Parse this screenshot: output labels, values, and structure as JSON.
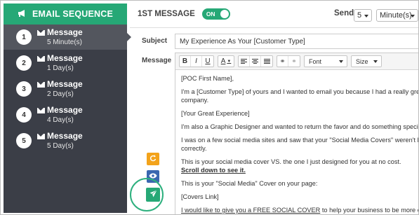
{
  "sidebar": {
    "header": "EMAIL SEQUENCE",
    "items": [
      {
        "number": "1",
        "title": "Message",
        "delay": "5 Minute(s)",
        "active": true
      },
      {
        "number": "2",
        "title": "Message",
        "delay": "1 Day(s)",
        "active": false
      },
      {
        "number": "3",
        "title": "Message",
        "delay": "2 Day(s)",
        "active": false
      },
      {
        "number": "4",
        "title": "Message",
        "delay": "4 Day(s)",
        "active": false
      },
      {
        "number": "5",
        "title": "Message",
        "delay": "5 Day(s)",
        "active": false
      }
    ]
  },
  "topbar": {
    "title": "1ST MESSAGE",
    "toggle_label": "ON",
    "send_label": "Send",
    "send_amount": "5",
    "send_unit": "Minute(s)"
  },
  "form": {
    "subject_label": "Subject",
    "subject_value": "My Experience As Your [Customer Type]",
    "message_label": "Message"
  },
  "toolbar": {
    "bold": "B",
    "italic": "I",
    "underline": "U",
    "text_color": "A",
    "font_label": "Font",
    "size_label": "Size"
  },
  "message_body": {
    "line1": "[POC First Name],",
    "line2a": "I'm a [Customer Type] of yours and I wanted to email you because I had a really great exper",
    "line2b": "company.",
    "line3": "[Your Great Experience]",
    "line4": "I'm also a Graphic Designer and wanted to return the favor and do something special for you",
    "line5a": "I was on a few social media sites and saw that your \"Social Media Covers\" weren't branded to",
    "line5b": "correctly.",
    "line6": "This is your social media cover VS. the one I just designed for you at no cost.",
    "line7": "Scroll down to see it.",
    "line8": "This is your \"Social Media\" Cover on your page:",
    "line9": "[Covers Link]",
    "line10_link": "I would like to give you a FREE SOCIAL COVER",
    "line10_rest": " to help your business to be more effective wit"
  },
  "colors": {
    "accent_green": "#26a876",
    "sidebar_bg": "#3b3e47",
    "sidebar_active": "#53565e",
    "refresh_orange": "#f3a31b",
    "preview_blue": "#3a67b0"
  },
  "icons": {
    "header": "megaphone-icon",
    "message": "envelope-icon",
    "refresh": "refresh-icon",
    "preview": "eye-icon",
    "send": "paper-plane-icon"
  }
}
